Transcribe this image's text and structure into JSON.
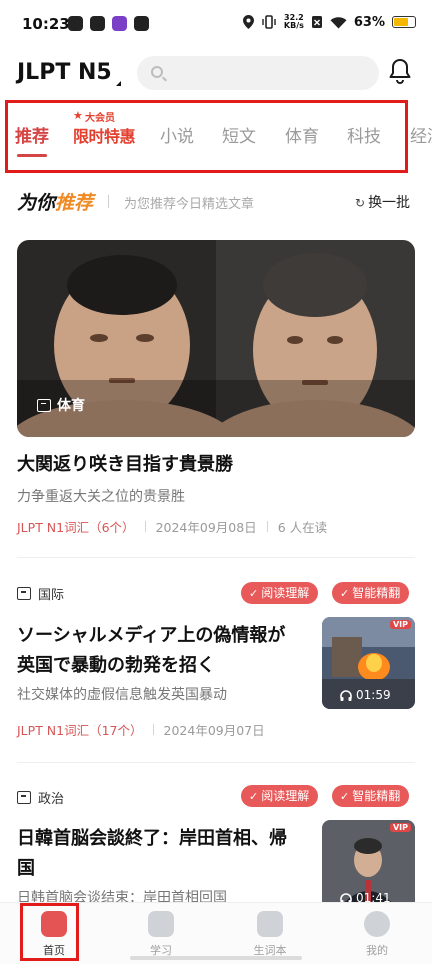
{
  "status_bar": {
    "time": "10:23",
    "net_speed_value": "32.2",
    "net_speed_unit": "KB/s",
    "battery": "63%",
    "battery_level": 0.63
  },
  "header": {
    "brand": "JLPT N5",
    "search_placeholder": ""
  },
  "tabs": {
    "items": [
      "推荐",
      "小说",
      "短文",
      "体育",
      "科技",
      "经济"
    ],
    "active_index": 0,
    "promo_top": "大会员",
    "promo_main": "限时特惠"
  },
  "recommend": {
    "title_plain": "为你",
    "title_accent": "推荐",
    "subtitle": "为您推荐今日精选文章",
    "refresh_label": "换一批"
  },
  "articles": [
    {
      "tag": "体育",
      "title": "大関返り咲き目指す貴景勝",
      "subtitle": "力争重返大关之位的贵景胜",
      "vocab": "JLPT N1词汇（6个）",
      "date": "2024年09月08日",
      "readers": "6 人在读"
    },
    {
      "category": "国际",
      "badges": [
        "阅读理解",
        "智能精翻"
      ],
      "title_line1": "ソーシャルメディア上の偽情報が",
      "title_line2": "英国で暴動の勃発を招く",
      "subtitle": "社交媒体的虚假信息触发英国暴动",
      "vocab": "JLPT N1词汇（17个）",
      "date": "2024年09月07日",
      "duration": "01:59",
      "vip": "VIP"
    },
    {
      "category": "政治",
      "badges": [
        "阅读理解",
        "智能精翻"
      ],
      "title_line1": "日韓首脳会談終了：岸田首相、帰",
      "title_line2": "国",
      "subtitle": "日韩首脑会谈结束：岸田首相回国",
      "duration": "01:41",
      "vip": "VIP"
    }
  ],
  "bottom_nav": {
    "items": [
      "首页",
      "学习",
      "生词本",
      "我的"
    ],
    "active_index": 0
  },
  "colors": {
    "accent_red": "#d64545",
    "badge_red": "#e85a5a",
    "recommend_orange": "#f08a24",
    "highlight_red": "#e21b1b"
  }
}
